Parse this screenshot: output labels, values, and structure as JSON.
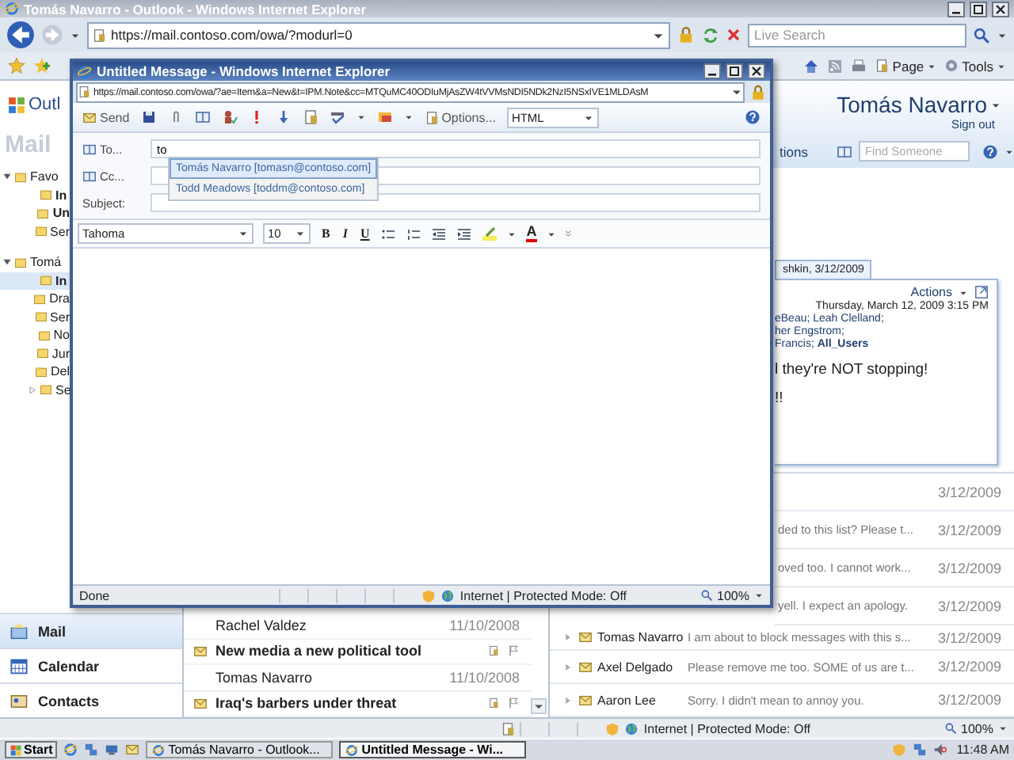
{
  "browser": {
    "title": "Tomás Navarro - Outlook - Windows Internet Explorer",
    "address": "https://mail.contoso.com/owa/?modurl=0",
    "search": {
      "placeholder": "Live Search"
    },
    "commands": [
      "Page",
      "Tools"
    ]
  },
  "outlook": {
    "logo": "Outl",
    "section": "Mail",
    "folders": [
      {
        "label": "Favo",
        "expanded": true,
        "selected": false,
        "unread": false,
        "children": [
          {
            "label": "In",
            "selected": false,
            "unread": true
          },
          {
            "label": "Un",
            "selected": false,
            "unread": true
          },
          {
            "label": "Ser",
            "selected": false,
            "unread": false
          }
        ]
      },
      {
        "label": "Tomá",
        "expanded": true,
        "selected": false,
        "unread": false,
        "children": [
          {
            "label": "In",
            "selected": true,
            "unread": true
          },
          {
            "label": "Dra",
            "selected": false,
            "unread": false
          },
          {
            "label": "Ser",
            "selected": false,
            "unread": false
          },
          {
            "label": "No",
            "selected": false,
            "unread": false
          },
          {
            "label": "Jur",
            "selected": false,
            "unread": false
          },
          {
            "label": "Del",
            "selected": false,
            "unread": false
          },
          {
            "label": "Se",
            "expanded": false,
            "selected": false,
            "unread": false
          }
        ]
      }
    ],
    "nav": [
      {
        "label": "Mail",
        "selected": true
      },
      {
        "label": "Calendar",
        "selected": false
      },
      {
        "label": "Contacts",
        "selected": false
      }
    ],
    "conversations": [
      {
        "sender": "Rachel Valdez",
        "date": "11/10/2008"
      },
      {
        "subject": "New media a new political tool",
        "sender": "Tomas Navarro",
        "date": "11/10/2008"
      },
      {
        "subject": "Iraq's barbers under threat"
      }
    ],
    "header": {
      "user": "Tomás Navarro",
      "sign_out": "Sign out",
      "options": "tions",
      "find": {
        "placeholder": "Find Someone"
      }
    },
    "reading": {
      "tab": "shkin, 3/12/2009",
      "actions": "Actions",
      "date": "Thursday, March 12, 2009 3:15 PM",
      "recipients": [
        "eBeau; Leah Clelland;",
        "her Engstrom;",
        "Francis; **All_Users**"
      ],
      "body": [
        "l they're NOT stopping!",
        "!!"
      ]
    },
    "messages": [
      {
        "kind": "partial",
        "date": "3/12/2009"
      },
      {
        "kind": "partial",
        "preview": "ded to this list? Please t...",
        "date": "3/12/2009"
      },
      {
        "kind": "partial",
        "preview": "oved too. I cannot work...",
        "date": "3/12/2009"
      },
      {
        "kind": "partial",
        "preview": "yell. I expect an apology.",
        "date": "3/12/2009"
      },
      {
        "kind": "full",
        "sender": "Tomas Navarro",
        "preview": "I am about to block messages with this s...",
        "date": "3/12/2009"
      },
      {
        "kind": "full",
        "sender": "Axel Delgado",
        "preview": "Please remove me too. SOME of us are t...",
        "date": "3/12/2009"
      },
      {
        "kind": "full",
        "sender": "Aaron Lee",
        "preview": "Sorry. I didn't mean to annoy you.",
        "date": "3/12/2009"
      }
    ]
  },
  "status_bar": {
    "zone": "Internet | Protected Mode: Off",
    "zoom": "100%"
  },
  "popup": {
    "title": "Untitled Message - Windows Internet Explorer",
    "address": "https://mail.contoso.com/owa/?ae=Item&a=New&t=IPM.Note&cc=MTQuMC40ODIuMjAsZW4tVVMsNDI5NDk2NzI5NSxIVE1MLDAsM",
    "send": "Send",
    "options": "Options...",
    "format": "HTML",
    "fields": [
      {
        "label": "To...",
        "value": "to"
      },
      {
        "label": "Cc..."
      },
      {
        "label": "Subject:"
      }
    ],
    "suggestions": [
      {
        "label": "Tomás Navarro [tomasn@contoso.com]",
        "selected": true
      },
      {
        "label": "Todd Meadows [toddm@contoso.com]",
        "selected": false
      }
    ],
    "font": "Tahoma",
    "size": "10",
    "styles": [
      "B",
      "I",
      "U"
    ],
    "font_color": "A",
    "more": "»",
    "status": "Done",
    "zone": "Internet | Protected Mode: Off",
    "zoom": "100%"
  },
  "taskbar": {
    "start": "Start",
    "tasks": [
      {
        "label": "Tomás Navarro - Outlook...",
        "selected": false
      },
      {
        "label": "Untitled Message - Wi...",
        "selected": true
      }
    ],
    "clock": "11:48 AM"
  }
}
